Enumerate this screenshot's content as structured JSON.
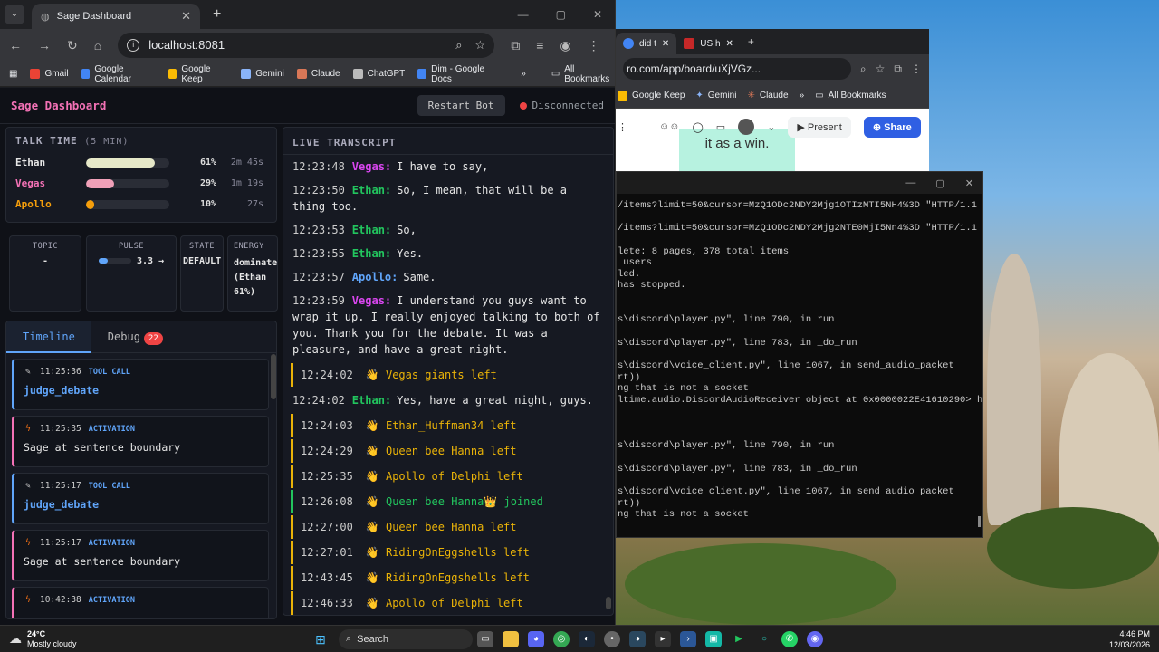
{
  "chrome_back": {
    "tabs": [
      {
        "label": "did t"
      },
      {
        "label": "US h"
      }
    ],
    "url": "ro.com/app/board/uXjVGz...",
    "bookmarks": [
      "Google Keep",
      "Gemini",
      "Claude",
      "All Bookmarks"
    ],
    "present_label": "Present",
    "share_label": "Share",
    "sticky_text": "it as a win."
  },
  "terminal": {
    "lines": [
      "/items?limit=50&cursor=MzQ1ODc2NDY2Mjg1OTIzMTI5NH4%3D \"HTTP/1.1",
      "",
      "/items?limit=50&cursor=MzQ1ODc2NDY2Mjg2NTE0MjI5Nn4%3D \"HTTP/1.1",
      "",
      "lete: 8 pages, 378 total items",
      " users",
      "led.",
      "has stopped.",
      "",
      "",
      "s\\discord\\player.py\", line 790, in run",
      "",
      "s\\discord\\player.py\", line 783, in _do_run",
      "",
      "s\\discord\\voice_client.py\", line 1067, in send_audio_packet",
      "rt))",
      "ng that is not a socket",
      "ltime.audio.DiscordAudioReceiver object at 0x0000022E41610290> h",
      "",
      "",
      "",
      "s\\discord\\player.py\", line 790, in run",
      "",
      "s\\discord\\player.py\", line 783, in _do_run",
      "",
      "s\\discord\\voice_client.py\", line 1067, in send_audio_packet",
      "rt))",
      "ng that is not a socket"
    ]
  },
  "chrome_main": {
    "tab_title": "Sage Dashboard",
    "url": "localhost:8081",
    "bookmarks": [
      {
        "label": "Gmail",
        "color": "#ea4335"
      },
      {
        "label": "Google Calendar",
        "color": "#4285f4"
      },
      {
        "label": "Google Keep",
        "color": "#fbbc04"
      },
      {
        "label": "Gemini",
        "color": "#8ab4f8"
      },
      {
        "label": "Claude",
        "color": "#d97757"
      },
      {
        "label": "ChatGPT",
        "color": "#bbbbbb"
      },
      {
        "label": "Dim - Google Docs",
        "color": "#4285f4"
      }
    ],
    "all_bookmarks": "All Bookmarks"
  },
  "dashboard": {
    "title": "Sage Dashboard",
    "restart_label": "Restart Bot",
    "status": "Disconnected",
    "talk_time": {
      "title": "TALK TIME",
      "window": "(5 MIN)",
      "rows": [
        {
          "name": "Ethan",
          "pct": "61%",
          "fraction": 0.83,
          "dur": "2m 45s",
          "color": "#e6e8c8",
          "name_color": "#e6e6e6"
        },
        {
          "name": "Vegas",
          "pct": "29%",
          "fraction": 0.34,
          "dur": "1m 19s",
          "color": "#f0a0b8",
          "name_color": "#f472b6"
        },
        {
          "name": "Apollo",
          "pct": "10%",
          "fraction": 0.1,
          "dur": "27s",
          "color": "#f59e0b",
          "name_color": "#f59e0b"
        }
      ]
    },
    "stats": {
      "topic_label": "TOPIC",
      "topic_value": "-",
      "pulse_label": "PULSE",
      "pulse_value": "3.3 →",
      "state_label": "STATE",
      "state_value": "DEFAULT",
      "energy_label": "ENERGY",
      "energy_value": "dominate (Ethan 61%)"
    },
    "tabs": {
      "timeline": "Timeline",
      "debug": "Debug",
      "debug_count": "22"
    },
    "events": [
      {
        "time": "11:25:36",
        "kind": "TOOL CALL",
        "body": "judge_debate",
        "type": "tool"
      },
      {
        "time": "11:25:35",
        "kind": "ACTIVATION",
        "body": "Sage at sentence boundary",
        "type": "act"
      },
      {
        "time": "11:25:17",
        "kind": "TOOL CALL",
        "body": "judge_debate",
        "type": "tool"
      },
      {
        "time": "11:25:17",
        "kind": "ACTIVATION",
        "body": "Sage at sentence boundary",
        "type": "act"
      },
      {
        "time": "10:42:38",
        "kind": "ACTIVATION",
        "body": "",
        "type": "act"
      }
    ],
    "transcript_title": "LIVE TRANSCRIPT",
    "transcript": [
      {
        "type": "msg",
        "ts": "12:23:48",
        "speaker": "Vegas:",
        "color": "#d946ef",
        "text": "I have to say,"
      },
      {
        "type": "msg",
        "ts": "12:23:50",
        "speaker": "Ethan:",
        "color": "#22c55e",
        "text": "So, I mean, that will be a thing too."
      },
      {
        "type": "msg",
        "ts": "12:23:53",
        "speaker": "Ethan:",
        "color": "#22c55e",
        "text": "So,"
      },
      {
        "type": "msg",
        "ts": "12:23:55",
        "speaker": "Ethan:",
        "color": "#22c55e",
        "text": "Yes."
      },
      {
        "type": "msg",
        "ts": "12:23:57",
        "speaker": "Apollo:",
        "color": "#60a5fa",
        "text": "Same."
      },
      {
        "type": "msg",
        "ts": "12:23:59",
        "speaker": "Vegas:",
        "color": "#d946ef",
        "text": "I understand you guys want to wrap it up. I really enjoyed talking to both of you. Thank you for the debate. It was a pleasure, and have a great night."
      },
      {
        "type": "sys",
        "ts": "12:24:02",
        "text": "👋 Vegas giants left"
      },
      {
        "type": "msg",
        "ts": "12:24:02",
        "speaker": "Ethan:",
        "color": "#22c55e",
        "text": "Yes, have a great night, guys."
      },
      {
        "type": "sys",
        "ts": "12:24:03",
        "text": "👋 Ethan_Huffman34 left"
      },
      {
        "type": "sys",
        "ts": "12:24:29",
        "text": "👋 Queen bee Hanna left"
      },
      {
        "type": "sys",
        "ts": "12:25:35",
        "text": "👋 Apollo of Delphi left"
      },
      {
        "type": "join",
        "ts": "12:26:08",
        "text": "👋 Queen bee Hanna👑 joined"
      },
      {
        "type": "sys",
        "ts": "12:27:00",
        "text": "👋 Queen bee Hanna left"
      },
      {
        "type": "sys",
        "ts": "12:27:01",
        "text": "👋 RidingOnEggshells left"
      },
      {
        "type": "sys",
        "ts": "12:43:45",
        "text": "👋 RidingOnEggshells left"
      },
      {
        "type": "sys",
        "ts": "12:46:33",
        "text": "👋 Apollo of Delphi left"
      }
    ]
  },
  "taskbar": {
    "weather_temp": "24°C",
    "weather_desc": "Mostly cloudy",
    "search": "Search",
    "time": "4:46 PM",
    "date": "12/03/2026"
  }
}
